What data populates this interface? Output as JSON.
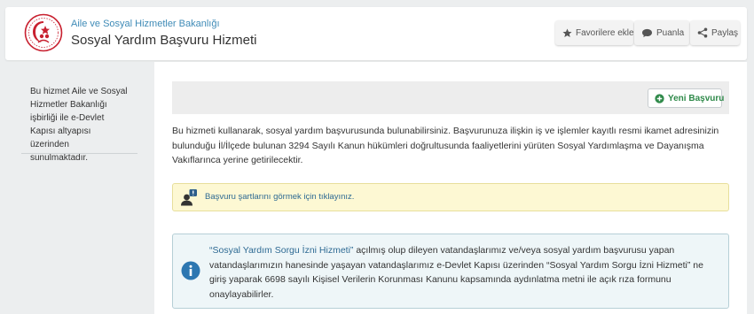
{
  "header": {
    "ministry": "Aile ve Sosyal Hizmetler Bakanlığı",
    "title": "Sosyal Yardım Başvuru Hizmeti",
    "buttons": {
      "favorite": "Favorilere ekle",
      "rate": "Puanla",
      "share": "Paylaş"
    },
    "icons": {
      "favorite": "star-icon",
      "rate": "speech-bubble-icon",
      "share": "share-icon"
    }
  },
  "sidebar": {
    "note": "Bu hizmet Aile ve Sosyal Hizmetler Bakanlığı işbirliği ile e-Devlet Kapısı altyapısı üzerinden sunulmaktadır."
  },
  "main": {
    "new_application": "Yeni Başvuru",
    "intro": "Bu hizmeti kullanarak, sosyal yardım başvurusunda bulunabilirsiniz. Başvurunuza ilişkin iş ve işlemler kayıtlı resmi ikamet adresinizin bulunduğu İl/İlçede bulunan 3294 Sayılı Kanun hükümleri doğrultusunda faaliyetlerini yürüten Sosyal Yardımlaşma ve Dayanışma Vakıflarınca yerine getirilecektir.",
    "conditions_link": "Başvuru şartlarını görmek için tıklayınız.",
    "info": {
      "link": "“Sosyal Yardım Sorgu İzni Hizmeti”",
      "text": " açılmış olup dileyen vatandaşlarımız ve/veya sosyal yardım başvurusu yapan vatandaşlarımızın hanesinde yaşayan vatandaşlarımız e-Devlet Kapısı üzerinden “Sosyal Yardım Sorgu İzni Hizmeti” ne giriş yaparak 6698 sayılı Kişisel Verilerin Korunması Kanunu kapsamında aydınlatma metni ile açık rıza formunu onaylayabilirler."
    }
  },
  "colors": {
    "brand_red": "#c8202f",
    "link_blue": "#2e6a93",
    "success_green": "#2f8a4a",
    "warning_bg": "#fdf8d3",
    "info_bg": "#eef6f8"
  }
}
